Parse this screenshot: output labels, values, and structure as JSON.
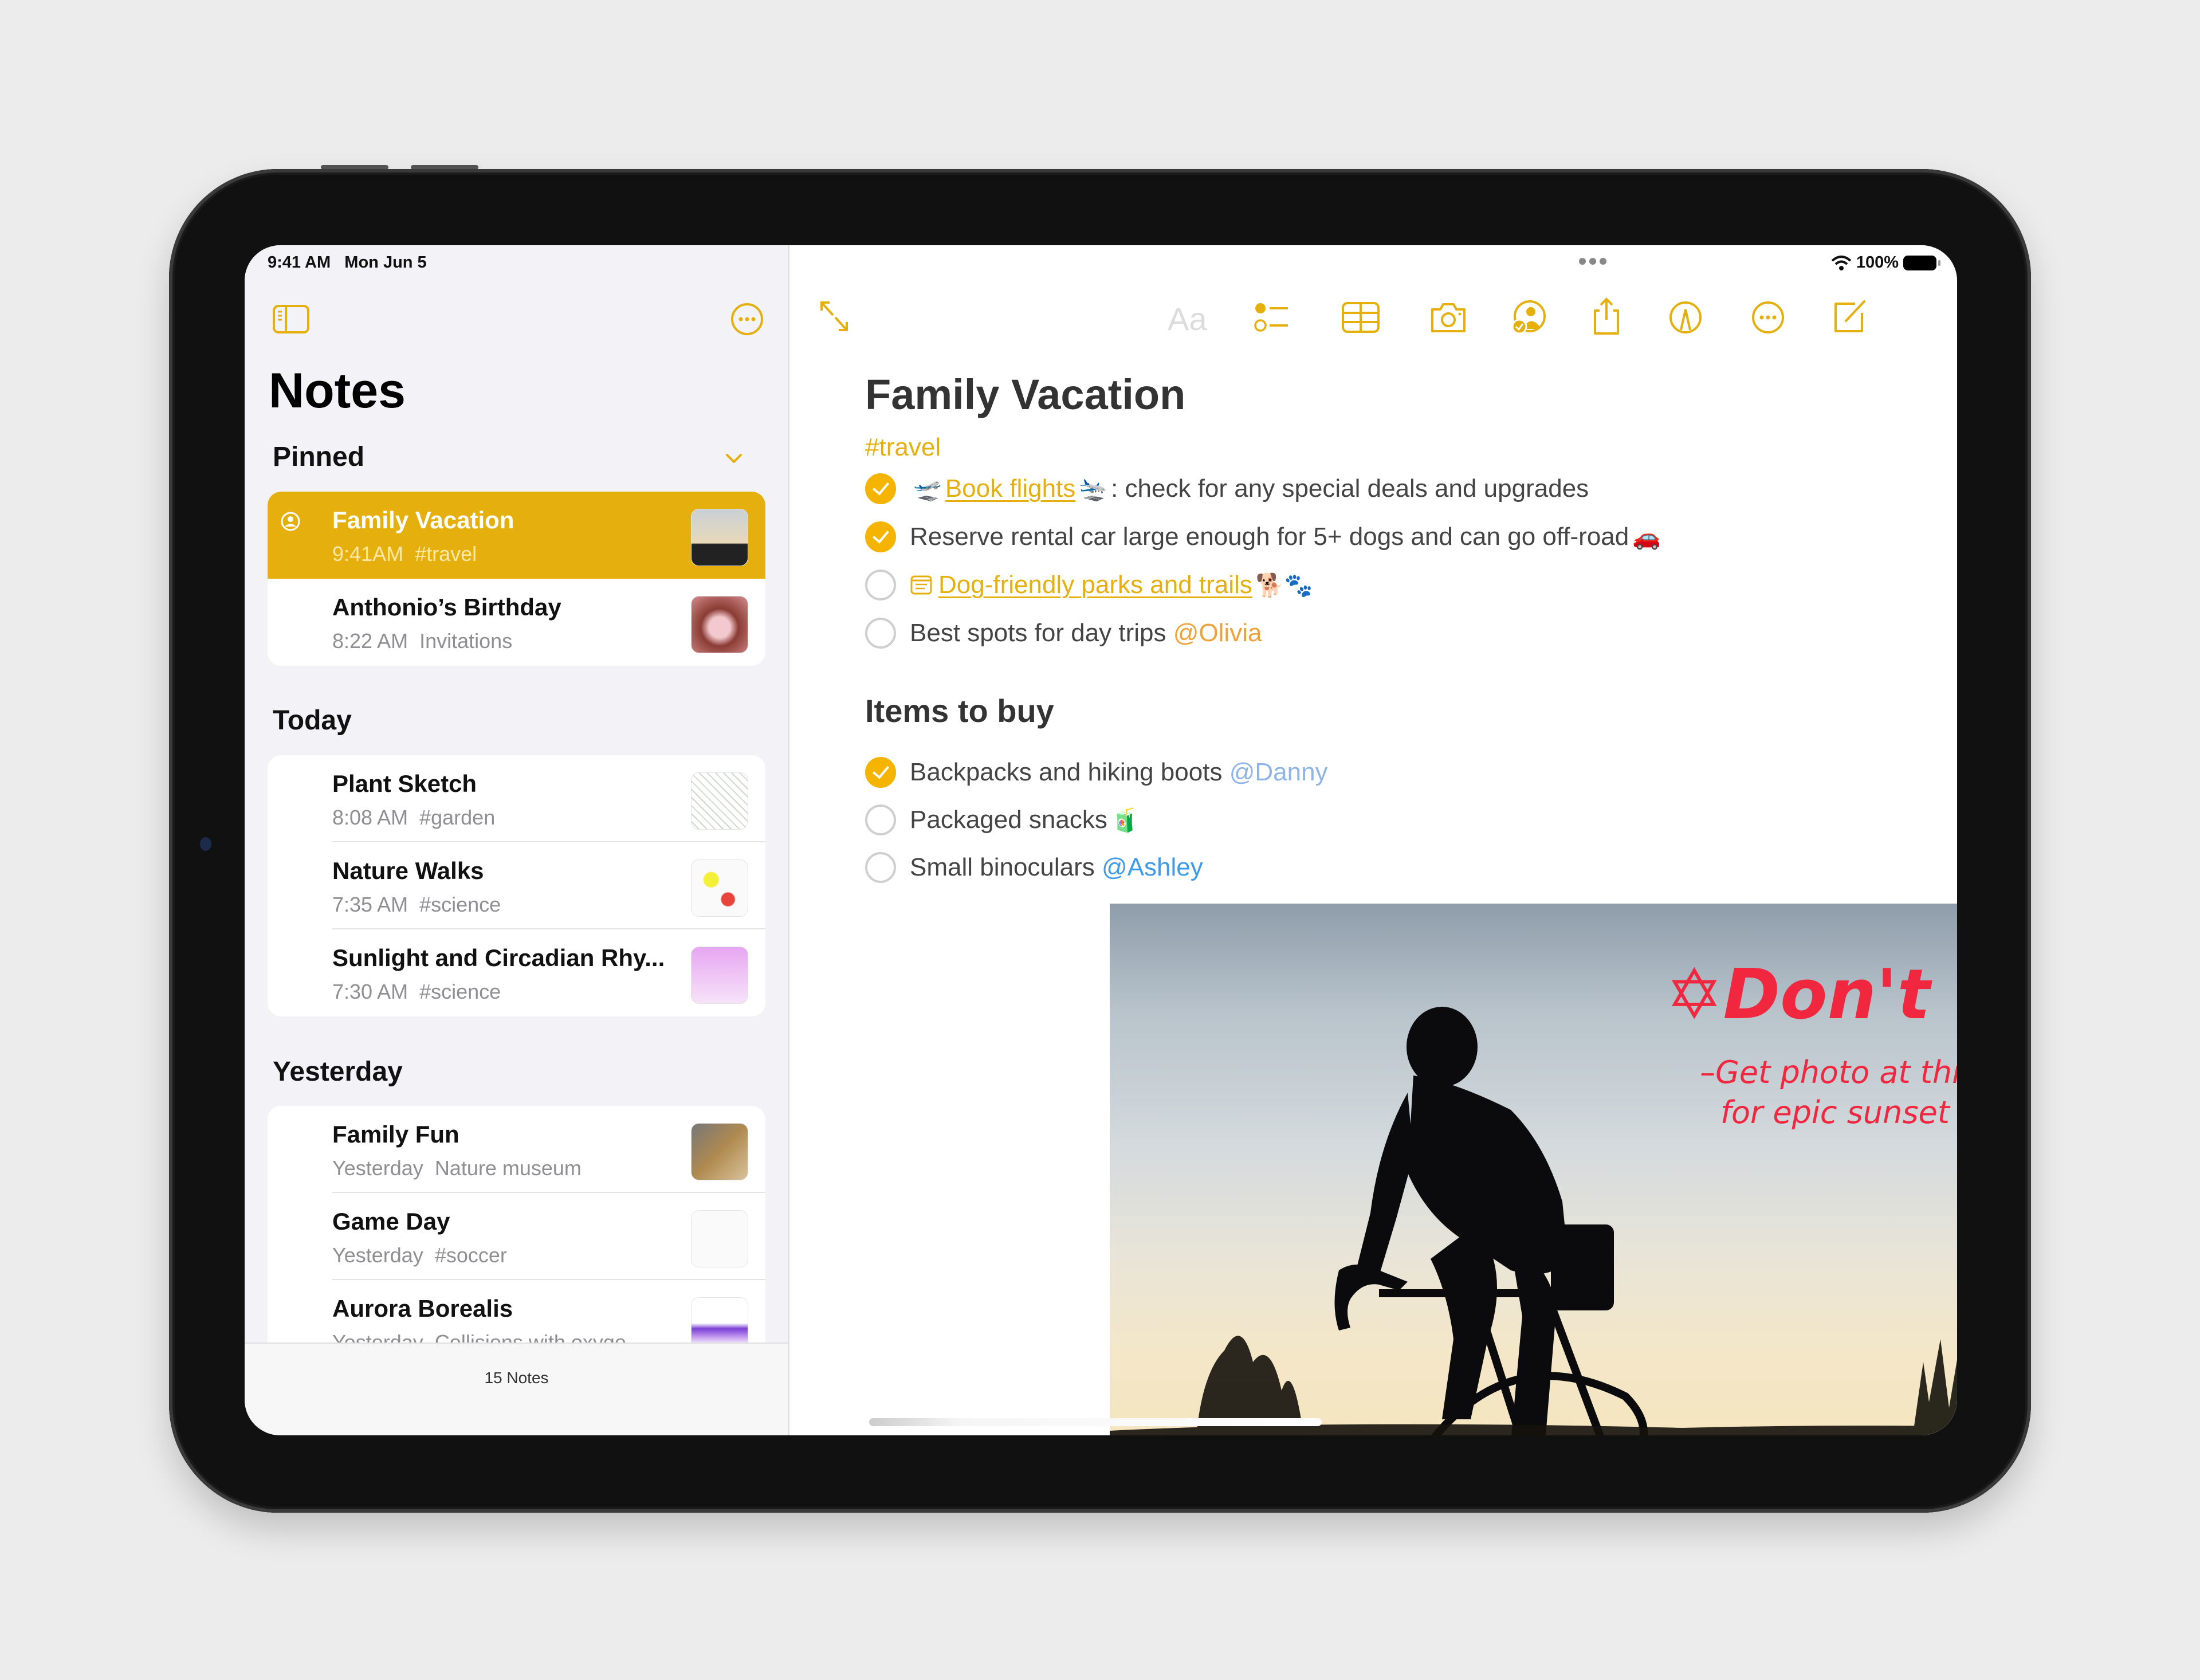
{
  "status_bar": {
    "time": "9:41 AM",
    "date": "Mon Jun 5",
    "battery": "100%"
  },
  "sidebar": {
    "title": "Notes",
    "toggle_icon": "sidebar-icon",
    "more_icon": "ellipsis-circle-icon",
    "sections": [
      {
        "title": "Pinned",
        "collapse_icon": "chevron-down-icon",
        "notes": [
          {
            "title": "Family Vacation",
            "time": "9:41AM",
            "snippet": "#travel",
            "selected": true,
            "shared": true
          },
          {
            "title": "Anthonio’s Birthday",
            "time": "8:22 AM",
            "snippet": "Invitations"
          }
        ]
      },
      {
        "title": "Today",
        "notes": [
          {
            "title": "Plant Sketch",
            "time": "8:08 AM",
            "snippet": "#garden"
          },
          {
            "title": "Nature Walks",
            "time": "7:35 AM",
            "snippet": "#science"
          },
          {
            "title": "Sunlight and Circadian Rhy...",
            "time": "7:30 AM",
            "snippet": "#science"
          }
        ]
      },
      {
        "title": "Yesterday",
        "notes": [
          {
            "title": "Family Fun",
            "time": "Yesterday",
            "snippet": "Nature museum"
          },
          {
            "title": "Game Day",
            "time": "Yesterday",
            "snippet": "#soccer"
          },
          {
            "title": "Aurora Borealis",
            "time": "Yesterday",
            "snippet": "Collisions with oxyge..."
          }
        ]
      }
    ],
    "footer_count": "15 Notes"
  },
  "toolbar": {
    "format_label": "Aa",
    "icons": [
      "expand-icon",
      "checklist-icon",
      "table-icon",
      "camera-icon",
      "collaborate-icon",
      "share-icon",
      "markup-icon",
      "more-icon",
      "compose-icon"
    ]
  },
  "note": {
    "title": "Family Vacation",
    "tag": "#travel",
    "checklist": [
      {
        "checked": true,
        "emoji_before": "🛫",
        "link": "Book flights",
        "emoji_after": "🛬",
        "text": ": check for any special deals and upgrades"
      },
      {
        "checked": true,
        "text": "Reserve rental car large enough for 5+ dogs and can go off-road",
        "emoji_after": "🚗"
      },
      {
        "checked": false,
        "note_link_icon": "note-link-icon",
        "link": "Dog-friendly parks and trails",
        "emoji_after": "🐕🐾"
      },
      {
        "checked": false,
        "text": "Best spots for day trips",
        "mention": "@Olivia"
      }
    ],
    "section_heading": "Items to buy",
    "items_to_buy": [
      {
        "checked": true,
        "text": "Backpacks and hiking boots",
        "mention": "@Danny"
      },
      {
        "checked": false,
        "text": "Packaged snacks",
        "emoji_after": "🧃"
      },
      {
        "checked": false,
        "text": "Small binoculars",
        "mention": "@Ashley"
      }
    ],
    "image": {
      "description": "Cyclist silhouette at sunset",
      "handwriting_title": "✡Don't forget",
      "handwriting_line1": "–Get photo at this location",
      "handwriting_line2": "for epic sunset"
    }
  },
  "colors": {
    "accent": "#e5b00d",
    "check": "#f4b400",
    "handwriting": "#f0273f",
    "mention_danny": "#8fb4e8",
    "mention_ashley": "#3d9bea",
    "mention_olivia": "#f0a23a"
  }
}
